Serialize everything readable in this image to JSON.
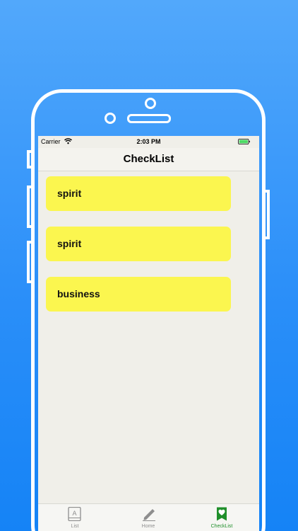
{
  "status_bar": {
    "carrier": "Carrier",
    "time": "2:03 PM",
    "wifi_icon": "wifi-icon",
    "battery_icon": "battery-icon",
    "battery_color": "#4cd964"
  },
  "nav": {
    "title": "CheckList"
  },
  "items": [
    {
      "label": "spirit"
    },
    {
      "label": "spirit"
    },
    {
      "label": "business"
    }
  ],
  "tabs": [
    {
      "label": "List",
      "icon": "list-book-icon",
      "active": false
    },
    {
      "label": "Home",
      "icon": "pencil-icon",
      "active": false
    },
    {
      "label": "CheckList",
      "icon": "heart-bookmark-icon",
      "active": true
    }
  ],
  "colors": {
    "card": "#fbf64f",
    "active_tab": "#1f8f2a",
    "inactive_tab": "#8e8e8e",
    "background_top": "#52a8fb",
    "background_bottom": "#1583f6"
  }
}
